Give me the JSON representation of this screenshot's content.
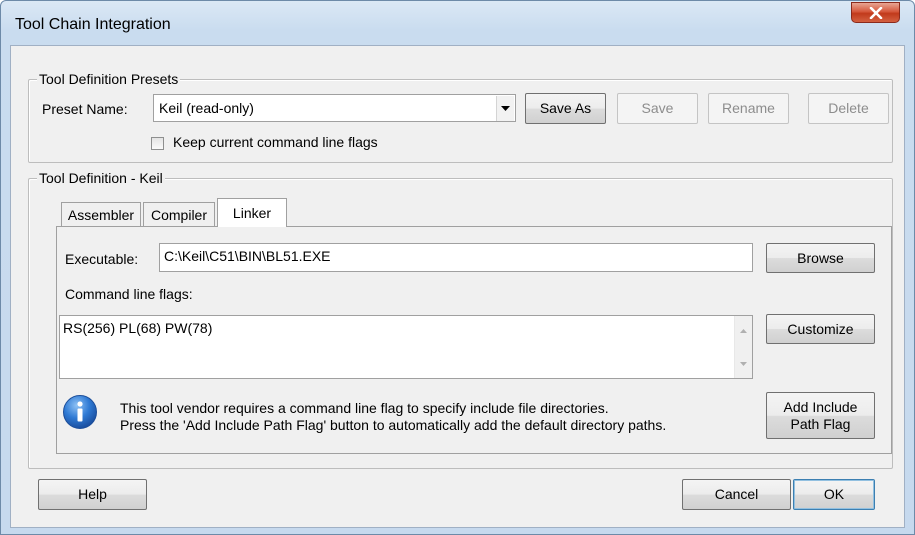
{
  "window": {
    "title": "Tool Chain Integration"
  },
  "presets": {
    "legend": "Tool Definition Presets",
    "preset_label": "Preset Name:",
    "preset_value": "Keil (read-only)",
    "save_as": "Save As",
    "save": "Save",
    "rename": "Rename",
    "delete": "Delete",
    "keep_flags_label": "Keep current command line flags",
    "keep_flags_checked": false
  },
  "definition": {
    "legend": "Tool Definition - Keil",
    "tabs": [
      {
        "label": "Assembler",
        "active": false
      },
      {
        "label": "Compiler",
        "active": false
      },
      {
        "label": "Linker",
        "active": true
      }
    ],
    "executable_label": "Executable:",
    "executable_value": "C:\\Keil\\C51\\BIN\\BL51.EXE",
    "browse": "Browse",
    "flags_label": "Command line flags:",
    "flags_value": "RS(256) PL(68) PW(78)",
    "customize": "Customize",
    "info_line1": "This tool vendor requires a command line flag to specify include file directories.",
    "info_line2": "Press the 'Add Include Path Flag' button to automatically add the default directory paths.",
    "add_include_line1": "Add Include",
    "add_include_line2": "Path Flag"
  },
  "footer": {
    "help": "Help",
    "cancel": "Cancel",
    "ok": "OK"
  },
  "icons": {
    "close": "close-icon",
    "dropdown": "chevron-down-icon",
    "info": "info-icon"
  },
  "colors": {
    "close_button": "#c13a1c",
    "info_icon": "#1c5fb8",
    "dialog_bg": "#f0f0f0",
    "frame": "#c6d9ee"
  }
}
